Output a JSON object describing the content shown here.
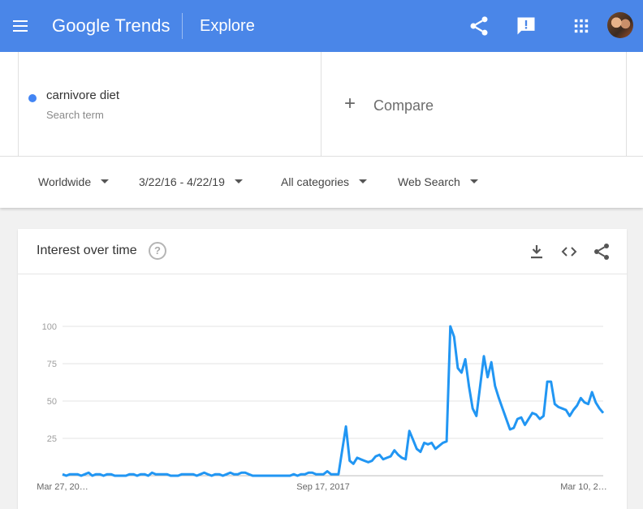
{
  "header": {
    "logo_google": "Google",
    "logo_trends": "Trends",
    "section": "Explore",
    "icons": [
      "menu-icon",
      "share-icon",
      "feedback-icon",
      "apps-icon"
    ]
  },
  "search": {
    "term": "carnivore diet",
    "term_subtitle": "Search term",
    "term_color": "#4285f4",
    "compare_label": "Compare"
  },
  "filters": {
    "region": "Worldwide",
    "date_range": "3/22/16 - 4/22/19",
    "category": "All categories",
    "search_type": "Web Search"
  },
  "interest_card": {
    "title": "Interest over time",
    "icons": [
      "help-icon",
      "download-icon",
      "embed-icon",
      "share-icon"
    ]
  },
  "chart_data": {
    "type": "line",
    "title": "",
    "xlabel": "",
    "ylabel": "",
    "ylim": [
      0,
      100
    ],
    "yticks": [
      25,
      50,
      75,
      100
    ],
    "x_tick_labels": [
      "Mar 27, 20…",
      "Sep 17, 2017",
      "Mar 10, 2…"
    ],
    "grid": true,
    "line_color": "#2196f3",
    "series": [
      {
        "values": [
          1,
          0,
          1,
          1,
          1,
          0,
          1,
          2,
          0,
          1,
          1,
          0,
          1,
          1,
          0,
          0,
          0,
          0,
          1,
          1,
          0,
          1,
          1,
          0,
          2,
          1,
          1,
          1,
          1,
          0,
          0,
          0,
          1,
          1,
          1,
          1,
          0,
          1,
          2,
          1,
          0,
          1,
          1,
          0,
          1,
          2,
          1,
          1,
          2,
          2,
          1,
          0,
          0,
          0,
          0,
          0,
          0,
          0,
          0,
          0,
          0,
          0,
          1,
          0,
          1,
          1,
          2,
          2,
          1,
          1,
          1,
          3,
          1,
          1,
          1,
          17,
          33,
          10,
          8,
          12,
          11,
          10,
          9,
          10,
          13,
          14,
          11,
          12,
          13,
          17,
          14,
          12,
          11,
          30,
          24,
          18,
          16,
          22,
          21,
          22,
          18,
          20,
          22,
          23,
          100,
          93,
          72,
          69,
          78,
          60,
          45,
          40,
          60,
          80,
          66,
          76,
          60,
          52,
          45,
          38,
          31,
          32,
          38,
          39,
          34,
          38,
          42,
          41,
          38,
          40,
          63,
          63,
          48,
          46,
          45,
          44,
          40,
          44,
          47,
          52,
          49,
          48,
          56,
          49,
          45,
          42
        ]
      }
    ]
  }
}
